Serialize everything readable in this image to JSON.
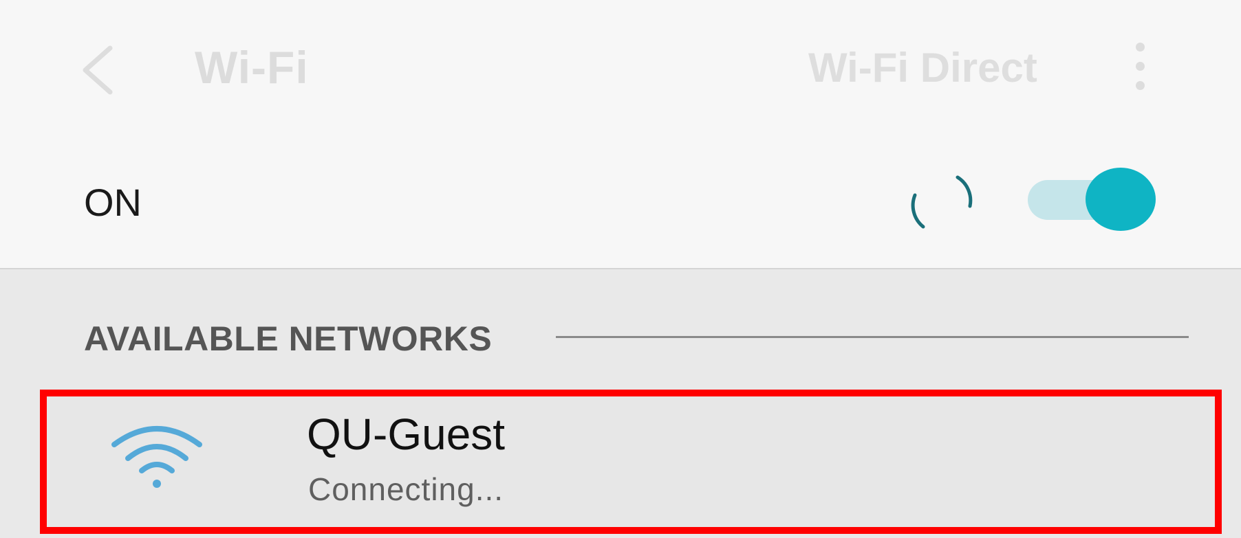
{
  "appbar": {
    "title": "Wi-Fi",
    "wifi_direct_label": "Wi-Fi Direct",
    "back_icon": "chevron-left-icon",
    "more_icon": "more-vertical-icon"
  },
  "wifi_toggle": {
    "label": "ON",
    "state": "on",
    "status_icon": "loading-spinner-icon"
  },
  "networks": {
    "header": "AVAILABLE NETWORKS",
    "items": [
      {
        "name": "QU-Guest",
        "status": "Connecting...",
        "icon": "wifi-signal-icon",
        "highlighted": true
      }
    ]
  },
  "colors": {
    "accent": "#0fb4c4",
    "toggle_track": "#c5e5ea",
    "highlight_border": "#ff0000",
    "wifi_icon": "#55a9d8"
  }
}
